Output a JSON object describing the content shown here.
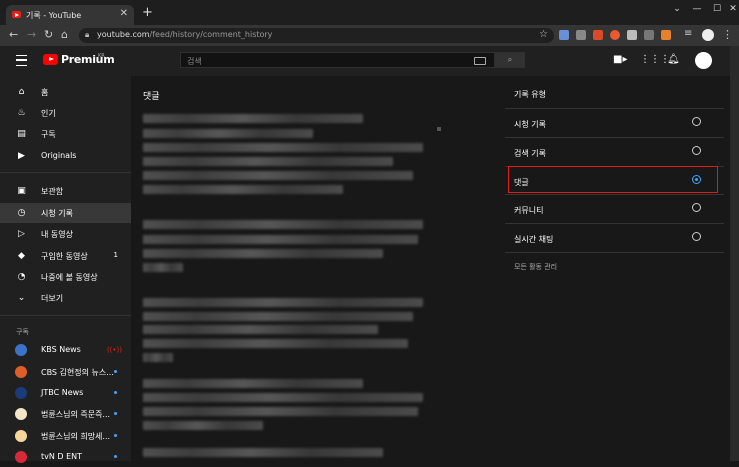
{
  "browser": {
    "tab_title": "기록 - YouTube",
    "url_host": "youtube.com",
    "url_path": "/feed/history/comment_history",
    "new_tab": "+",
    "tab_close": "✕",
    "window_buttons": [
      "⌄",
      "—",
      "☐",
      "✕"
    ]
  },
  "header": {
    "brand": "Premium",
    "region": "KR",
    "search_placeholder": "검색"
  },
  "sidebar": {
    "items": [
      {
        "label": "홈",
        "icon": "home-icon"
      },
      {
        "label": "인기",
        "icon": "flame-icon"
      },
      {
        "label": "구독",
        "icon": "subscriptions-icon"
      },
      {
        "label": "Originals",
        "icon": "originals-icon"
      },
      {
        "label": "보관함",
        "icon": "library-icon"
      },
      {
        "label": "시청 기록",
        "icon": "history-icon",
        "active": true
      },
      {
        "label": "내 동영상",
        "icon": "my-videos-icon"
      },
      {
        "label": "구입한 동영상",
        "icon": "tag-icon",
        "count": "1"
      },
      {
        "label": "나중에 볼 동영상",
        "icon": "clock-icon"
      },
      {
        "label": "더보기",
        "icon": "chevron-down-icon"
      }
    ],
    "subs_label": "구독",
    "subscriptions": [
      {
        "name": "KBS News",
        "badge": "live"
      },
      {
        "name": "CBS 김현정의 뉴스...",
        "badge": "dot"
      },
      {
        "name": "JTBC News",
        "badge": "dot"
      },
      {
        "name": "법륜스님의 즉문즉...",
        "badge": "dot"
      },
      {
        "name": "법륜스님의 희망세...",
        "badge": "dot"
      },
      {
        "name": "tvN D ENT",
        "badge": "dot"
      }
    ]
  },
  "main": {
    "title": "댓글"
  },
  "panel": {
    "title": "기록 유형",
    "options": [
      {
        "label": "시청 기록",
        "selected": false
      },
      {
        "label": "검색 기록",
        "selected": false
      },
      {
        "label": "댓글",
        "selected": true
      },
      {
        "label": "커뮤니티",
        "selected": false
      },
      {
        "label": "실시간 채팅",
        "selected": false
      }
    ],
    "manage": "모든 활동 관리"
  },
  "colors": {
    "accent": "#3ea6ff",
    "brand_red": "#ff0000",
    "highlight": "#e01b1b"
  }
}
